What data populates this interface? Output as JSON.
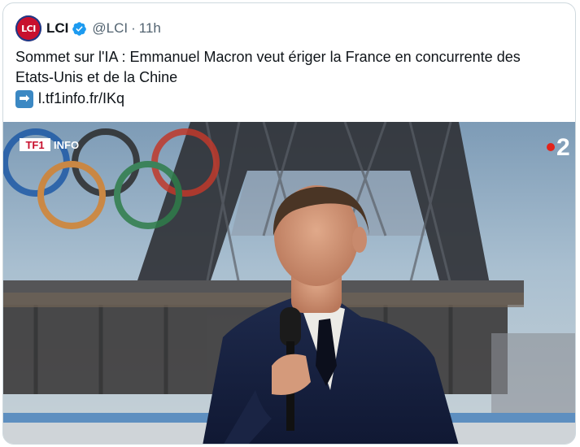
{
  "tweet": {
    "author_name": "LCI",
    "avatar_text": "LCI",
    "handle": "@LCI",
    "separator": "·",
    "time": "11h",
    "text_line1": "Sommet sur l'IA : Emmanuel Macron veut ériger la France en concurrente des",
    "text_line2": "Etats-Unis et de la Chine",
    "link_emoji": "➡",
    "link_text": "l.tf1info.fr/IKq"
  },
  "media": {
    "logo_tf1": "TF1",
    "logo_info": "INFO",
    "channel_number": "2"
  },
  "colors": {
    "verified": "#1d9bf0",
    "handle_gray": "#536471",
    "avatar_red": "#c8102e"
  }
}
